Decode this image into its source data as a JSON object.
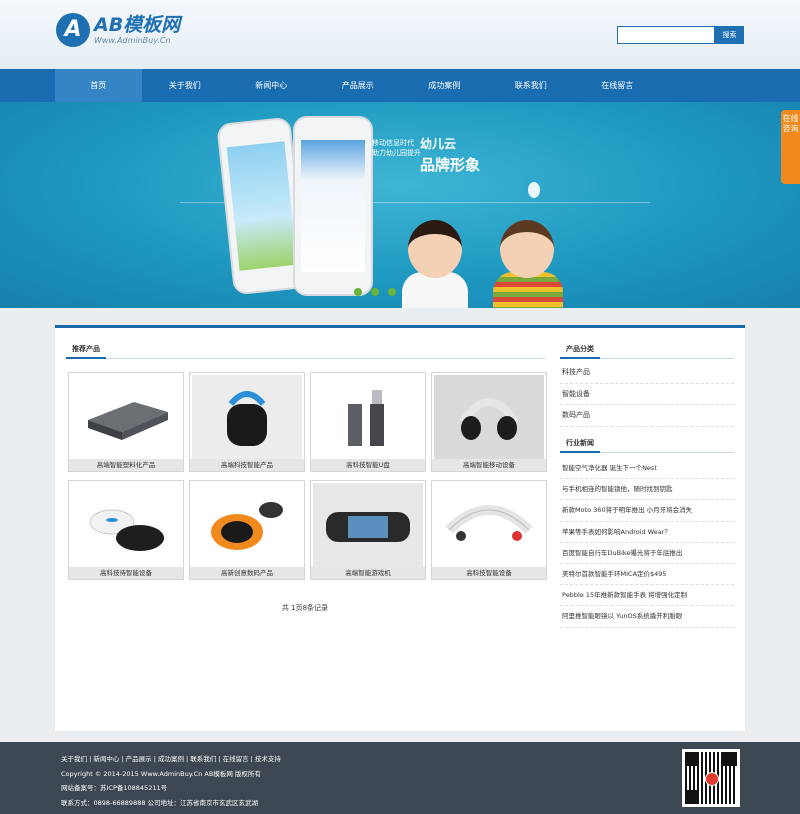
{
  "header": {
    "logo_mark": "A",
    "logo_title": "AB模板网",
    "logo_url": "Www.AdminBuy.Cn",
    "search_placeholder": "",
    "search_button": "搜索"
  },
  "nav": [
    {
      "label": "首页",
      "active": true
    },
    {
      "label": "关于我们"
    },
    {
      "label": "新闻中心"
    },
    {
      "label": "产品展示"
    },
    {
      "label": "成功案例"
    },
    {
      "label": "联系我们"
    },
    {
      "label": "在线留言"
    }
  ],
  "banner": {
    "tagline_1": "移动信息时代",
    "tagline_2": "助力幼儿园提升",
    "brand_1": "幼儿云",
    "brand_2": "品牌形象",
    "slides": 3,
    "side_tab": "在线咨询"
  },
  "products": {
    "title": "推荐产品",
    "items": [
      {
        "caption": "高端智能塑料化产品",
        "icon": "router-box"
      },
      {
        "caption": "高端科技智能产品",
        "icon": "speaker-device"
      },
      {
        "caption": "高科技智能U盘",
        "icon": "usb-drive"
      },
      {
        "caption": "高端智能移动设备",
        "icon": "headset-device"
      },
      {
        "caption": "高科技待智能设备",
        "icon": "wireless-mouse"
      },
      {
        "caption": "高新创意数码产品",
        "icon": "projector-device"
      },
      {
        "caption": "高端智能游戏机",
        "icon": "game-console"
      },
      {
        "caption": "高科技智能设备",
        "icon": "wearable-band"
      }
    ],
    "pager": "共 1页8条记录"
  },
  "categories": {
    "title": "产品分类",
    "items": [
      "科技产品",
      "智能设备",
      "数码产品"
    ]
  },
  "news": {
    "title": "行业新闻",
    "items": [
      "智能空气净化器 诞生下一个Nest",
      "与手机相连的智能锁他，随时找到钥匙",
      "新款Moto 360将于明年推出 小月牙将会消失",
      "苹果等手表如何影响Android Wear？",
      "百度智能自行车DuBike曝光将于年底推出",
      "美特尔首款智能手环MICA定价$495",
      "Pebble 15年推新款智能手表 将增强化定制",
      "阿里推智能眼镜以 YunOS系统撬开利胎眼"
    ]
  },
  "footer": {
    "links": "关于我们 | 新闻中心 | 产品展示 | 成功案例 | 联系我们 | 在线留言 | 技术支持",
    "copyright": "Copyright © 2014-2015 Www.AdminBuy.Cn AB模板网 版权所有",
    "icp": "网站备案号：苏ICP备108845211号",
    "contact": "联系方式：0898-66889888 公司地址：江苏省南京市玄武区玄武湖"
  },
  "colors": {
    "primary": "#1a6cb0",
    "accent": "#f08a1e",
    "footer": "#3c4752"
  }
}
